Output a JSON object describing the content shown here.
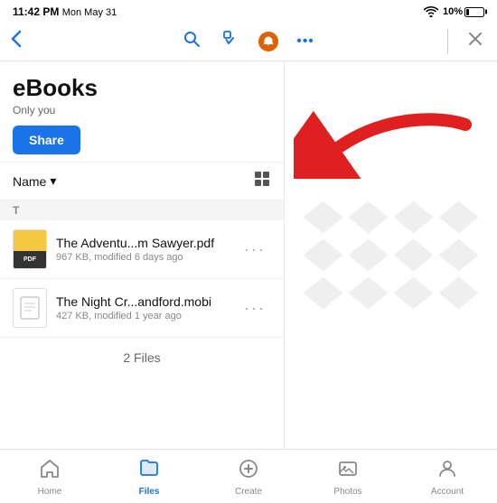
{
  "statusBar": {
    "time": "11:42 PM",
    "date": "Mon May 31",
    "battery": "10%"
  },
  "topNav": {
    "backIcon": "‹",
    "searchIcon": "search",
    "checkIcon": "checkmark",
    "moreIcon": "•••",
    "closeIcon": "✕"
  },
  "folder": {
    "title": "eBooks",
    "subtitle": "Only you",
    "shareLabel": "Share"
  },
  "sortBar": {
    "sortLabel": "Name",
    "sortIcon": "▾"
  },
  "sectionHeader": "T",
  "files": [
    {
      "name": "The Adventu...m Sawyer.pdf",
      "meta": "967 KB, modified 6 days ago",
      "hasThumb": true
    },
    {
      "name": "The Night Cr...andford.mobi",
      "meta": "427 KB, modified 1 year ago",
      "hasThumb": false
    }
  ],
  "filesCount": "2 Files",
  "tabBar": {
    "items": [
      {
        "id": "home",
        "label": "Home",
        "icon": "home"
      },
      {
        "id": "files",
        "label": "Files",
        "icon": "folder",
        "active": true
      },
      {
        "id": "create",
        "label": "Create",
        "icon": "plus-circle"
      },
      {
        "id": "photos",
        "label": "Photos",
        "icon": "photo"
      },
      {
        "id": "account",
        "label": "Account",
        "icon": "person"
      }
    ]
  }
}
